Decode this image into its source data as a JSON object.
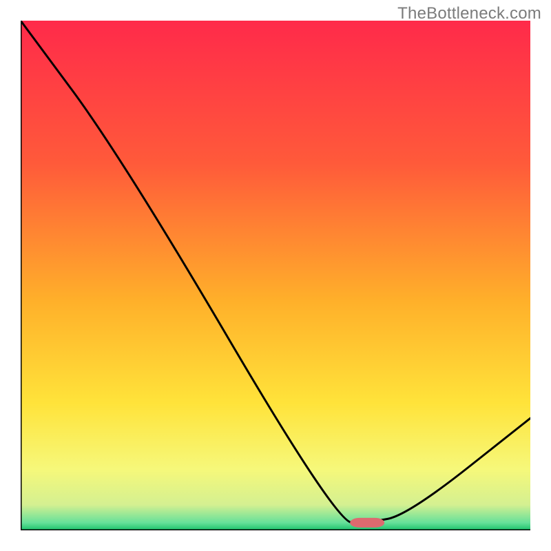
{
  "watermark": "TheBottleneck.com",
  "chart_data": {
    "type": "line",
    "title": "",
    "xlabel": "",
    "ylabel": "",
    "xlim": [
      0,
      100
    ],
    "ylim": [
      0,
      100
    ],
    "x": [
      0,
      20,
      62,
      68,
      76,
      100
    ],
    "values": [
      100,
      73,
      1.5,
      1.5,
      3,
      22
    ],
    "marker": {
      "x": 68,
      "y": 1.5
    },
    "grid": false,
    "legend": false
  },
  "gradient_stops": [
    {
      "offset": 0.0,
      "color": "#ff2a4a"
    },
    {
      "offset": 0.28,
      "color": "#ff5a3a"
    },
    {
      "offset": 0.55,
      "color": "#ffb02a"
    },
    {
      "offset": 0.75,
      "color": "#ffe33a"
    },
    {
      "offset": 0.88,
      "color": "#f6f87a"
    },
    {
      "offset": 0.95,
      "color": "#d4f091"
    },
    {
      "offset": 0.985,
      "color": "#66e09a"
    },
    {
      "offset": 1.0,
      "color": "#18c06a"
    }
  ],
  "marker_style": {
    "fill": "#dd6a6f",
    "rx": 14,
    "width": 50,
    "height": 14
  },
  "axis_stroke": "#000000",
  "axis_width": 3,
  "curve_stroke": "#000000",
  "curve_width": 3
}
